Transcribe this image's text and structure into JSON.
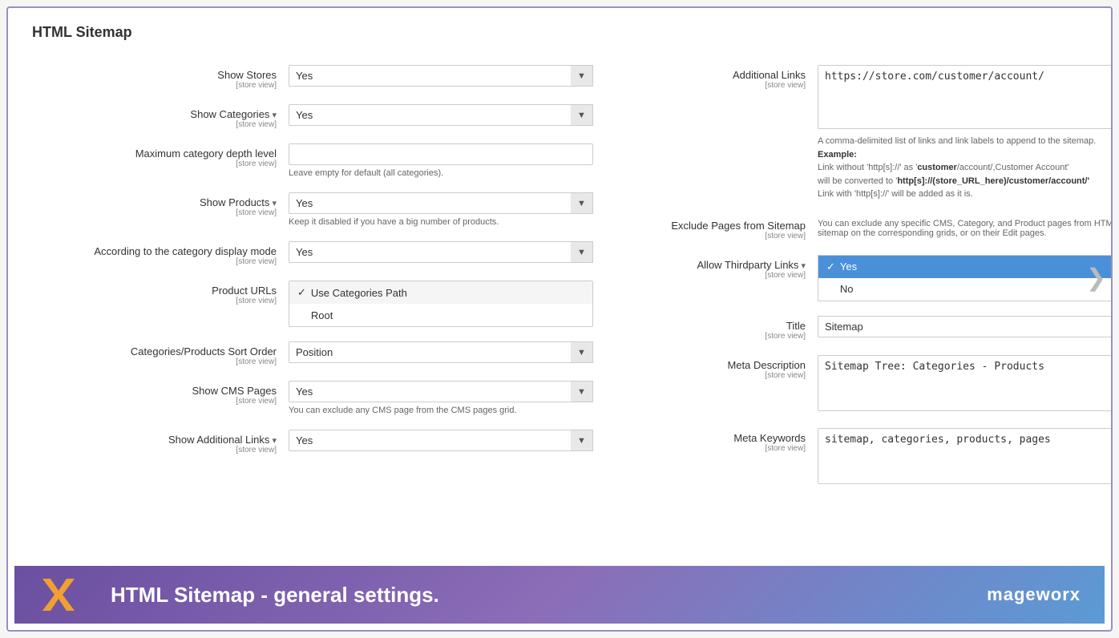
{
  "page": {
    "title": "HTML Sitemap",
    "bottom_title": "HTML Sitemap - general settings."
  },
  "brand": {
    "name": "mageworx",
    "x_char": "x"
  },
  "left_panel": {
    "show_stores": {
      "label": "Show Stores",
      "store_view": "[store view]",
      "value": "Yes"
    },
    "show_categories": {
      "label": "Show Categories",
      "store_view": "[store view]",
      "value": "Yes",
      "has_arrow": true
    },
    "max_category_depth": {
      "label": "Maximum category depth level",
      "store_view": "[store view]",
      "value": "",
      "hint": "Leave empty for default (all categories)."
    },
    "show_products": {
      "label": "Show Products",
      "store_view": "[store view]",
      "value": "Yes",
      "has_arrow": true,
      "hint": "Keep it disabled if you have a big number of products."
    },
    "category_display_mode": {
      "label": "According to the category display mode",
      "store_view": "[store view]",
      "value": "Yes"
    },
    "product_urls": {
      "label": "Product URLs",
      "store_view": "[store view]",
      "options": [
        {
          "label": "Use Categories Path",
          "selected": true
        },
        {
          "label": "Root",
          "selected": false
        }
      ]
    },
    "sort_order": {
      "label": "Categories/Products Sort Order",
      "store_view": "[store view]",
      "value": "Position"
    },
    "show_cms_pages": {
      "label": "Show CMS Pages",
      "store_view": "[store view]",
      "value": "Yes",
      "hint": "You can exclude any CMS page from the CMS pages grid."
    },
    "show_additional_links": {
      "label": "Show Additional Links",
      "store_view": "[store view]",
      "value": "Yes",
      "has_arrow": true
    }
  },
  "right_panel": {
    "additional_links": {
      "label": "Additional Links",
      "store_view": "[store view]",
      "value": "https://store.com/customer/account/",
      "notes_line1": "A comma-delimited list of links and link labels to append to the sitemap.",
      "notes_example_label": "Example:",
      "notes_line2": "Link without 'http[s]://' as '",
      "notes_link1": "customer",
      "notes_mid1": "/account/,Customer Account'",
      "notes_line3": "will be converted to '",
      "notes_link2": "http[s]://(store_URL_here)/customer/account/'",
      "notes_line4": "Link with 'http[s]://' will be added as it is."
    },
    "exclude_pages": {
      "label": "Exclude Pages from Sitemap",
      "store_view": "[store view]",
      "hint": "You can exclude any specific CMS, Category, and Product pages from HTML sitemap on the corresponding grids, or on their Edit pages."
    },
    "allow_thirdparty_links": {
      "label": "Allow Thirdparty Links",
      "store_view": "[store view]",
      "has_arrow": true,
      "options": [
        {
          "label": "Yes",
          "selected": true
        },
        {
          "label": "No",
          "selected": false
        }
      ]
    },
    "title": {
      "label": "Title",
      "store_view": "[store view]",
      "value": "Sitemap"
    },
    "meta_description": {
      "label": "Meta Description",
      "store_view": "[store view]",
      "value": "Sitemap Tree: Categories - Products"
    },
    "meta_keywords": {
      "label": "Meta Keywords",
      "store_view": "[store view]",
      "value": "sitemap, categories, products, pages"
    }
  },
  "chevron": "❯",
  "colors": {
    "yes_bg": "#4a90d9",
    "gradient_start": "#6b4fa0",
    "gradient_end": "#5b9bd5"
  }
}
